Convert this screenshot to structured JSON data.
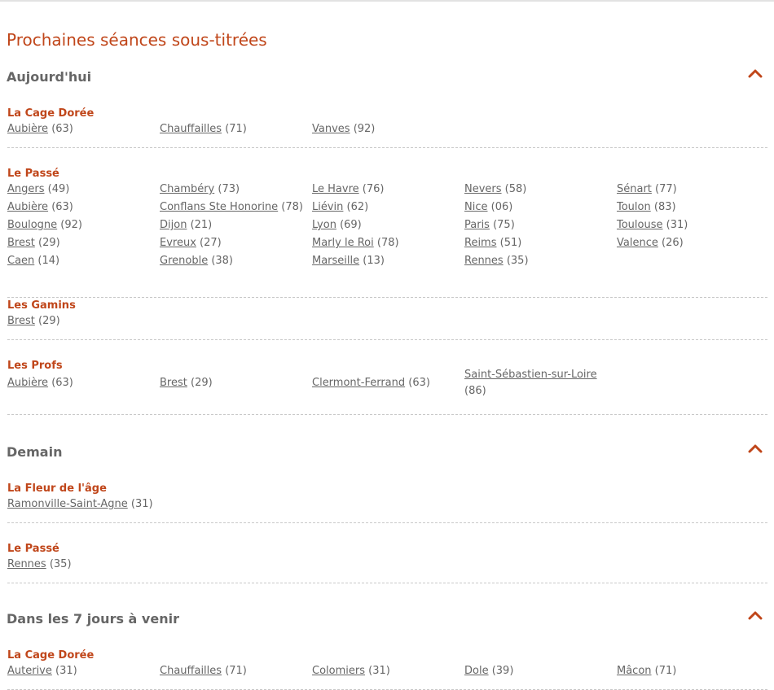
{
  "page_title": "Prochaines séances sous-titrées",
  "colors": {
    "accent": "#c0461a",
    "text": "#666666",
    "divider": "#c8c8c8"
  },
  "sections": [
    {
      "title": "Aujourd'hui",
      "icon": "chevron-up-icon",
      "films": [
        {
          "title": "La Cage Dorée",
          "locations": [
            {
              "city": "Aubière",
              "dept": "(63)"
            },
            {
              "city": "Chauffailles",
              "dept": "(71)"
            },
            {
              "city": "Vanves",
              "dept": "(92)"
            }
          ]
        },
        {
          "title": "Le Passé",
          "locations": [
            {
              "city": "Angers",
              "dept": "(49)"
            },
            {
              "city": "Chambéry",
              "dept": "(73)"
            },
            {
              "city": "Le Havre",
              "dept": "(76)"
            },
            {
              "city": "Nevers",
              "dept": "(58)"
            },
            {
              "city": "Sénart",
              "dept": "(77)"
            },
            {
              "city": "Aubière",
              "dept": "(63)"
            },
            {
              "city": "Conflans Ste Honorine",
              "dept": "(78)"
            },
            {
              "city": "Liévin",
              "dept": "(62)"
            },
            {
              "city": "Nice",
              "dept": "(06)"
            },
            {
              "city": "Toulon",
              "dept": "(83)"
            },
            {
              "city": "Boulogne",
              "dept": "(92)"
            },
            {
              "city": "Dijon",
              "dept": "(21)"
            },
            {
              "city": "Lyon",
              "dept": "(69)"
            },
            {
              "city": "Paris",
              "dept": "(75)"
            },
            {
              "city": "Toulouse",
              "dept": "(31)"
            },
            {
              "city": "Brest",
              "dept": "(29)"
            },
            {
              "city": "Evreux",
              "dept": "(27)"
            },
            {
              "city": "Marly le Roi",
              "dept": "(78)"
            },
            {
              "city": "Reims",
              "dept": "(51)"
            },
            {
              "city": "Valence",
              "dept": "(26)"
            },
            {
              "city": "Caen",
              "dept": "(14)"
            },
            {
              "city": "Grenoble",
              "dept": "(38)"
            },
            {
              "city": "Marseille",
              "dept": "(13)"
            },
            {
              "city": "Rennes",
              "dept": "(35)"
            }
          ]
        },
        {
          "title": "Les Gamins",
          "locations": [
            {
              "city": "Brest",
              "dept": "(29)"
            }
          ]
        },
        {
          "title": "Les Profs",
          "locations": [
            {
              "city": "Aubière",
              "dept": "(63)"
            },
            {
              "city": "Brest",
              "dept": "(29)"
            },
            {
              "city": "Clermont-Ferrand",
              "dept": "(63)"
            },
            {
              "city": "Saint-Sébastien-sur-Loire",
              "dept": "(86)"
            }
          ]
        }
      ]
    },
    {
      "title": "Demain",
      "icon": "chevron-up-icon",
      "films": [
        {
          "title": "La Fleur de l'âge",
          "locations": [
            {
              "city": "Ramonville-Saint-Agne",
              "dept": "(31)"
            }
          ]
        },
        {
          "title": "Le Passé",
          "locations": [
            {
              "city": "Rennes",
              "dept": "(35)"
            }
          ]
        }
      ]
    },
    {
      "title": "Dans les 7 jours à venir",
      "icon": "chevron-up-icon",
      "films": [
        {
          "title": "La Cage Dorée",
          "locations": [
            {
              "city": "Auterive",
              "dept": "(31)"
            },
            {
              "city": "Chauffailles",
              "dept": "(71)"
            },
            {
              "city": "Colomiers",
              "dept": "(31)"
            },
            {
              "city": "Dole",
              "dept": "(39)"
            },
            {
              "city": "Mâcon",
              "dept": "(71)"
            }
          ]
        }
      ]
    }
  ]
}
